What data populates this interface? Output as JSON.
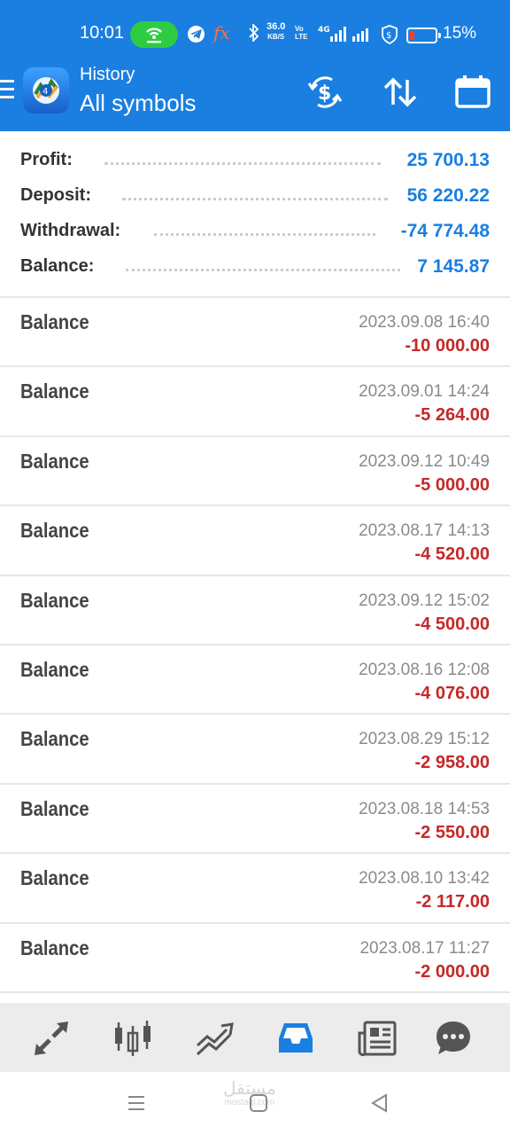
{
  "status_bar": {
    "time": "10:01",
    "speed_value": "36.0",
    "speed_unit": "KB/S",
    "volte_line1": "Vo",
    "volte_line2": "LTE",
    "network": "4G",
    "battery_percent": "15%",
    "battery_level_percent": 15,
    "fx_label": "fx"
  },
  "header": {
    "subtitle": "History",
    "title": "All symbols",
    "icons": [
      "currency-exchange-icon",
      "sort-icon",
      "calendar-icon"
    ]
  },
  "summary": [
    {
      "label": "Profit:",
      "value": "25 700.13"
    },
    {
      "label": "Deposit:",
      "value": "56 220.22"
    },
    {
      "label": "Withdrawal:",
      "value": "-74 774.48"
    },
    {
      "label": "Balance:",
      "value": "7 145.87"
    }
  ],
  "history": [
    {
      "name": "Balance",
      "date": "2023.09.08 16:40",
      "amount": "-10 000.00"
    },
    {
      "name": "Balance",
      "date": "2023.09.01 14:24",
      "amount": "-5 264.00"
    },
    {
      "name": "Balance",
      "date": "2023.09.12 10:49",
      "amount": "-5 000.00"
    },
    {
      "name": "Balance",
      "date": "2023.08.17 14:13",
      "amount": "-4 520.00"
    },
    {
      "name": "Balance",
      "date": "2023.09.12 15:02",
      "amount": "-4 500.00"
    },
    {
      "name": "Balance",
      "date": "2023.08.16 12:08",
      "amount": "-4 076.00"
    },
    {
      "name": "Balance",
      "date": "2023.08.29 15:12",
      "amount": "-2 958.00"
    },
    {
      "name": "Balance",
      "date": "2023.08.18 14:53",
      "amount": "-2 550.00"
    },
    {
      "name": "Balance",
      "date": "2023.08.10 13:42",
      "amount": "-2 117.00"
    },
    {
      "name": "Balance",
      "date": "2023.08.17 11:27",
      "amount": "-2 000.00"
    }
  ],
  "bottom_nav": {
    "items": [
      "quotes-icon",
      "chart-icon",
      "trade-icon",
      "history-icon",
      "news-icon",
      "chat-icon"
    ],
    "active": "history-icon"
  },
  "watermark": {
    "line1": "مستقل",
    "line2": "mostaql.com"
  },
  "colors": {
    "primary": "#1a7fe0",
    "negative": "#c62828",
    "hotspot": "#2ecc40",
    "battery_low": "#ff3b30"
  }
}
